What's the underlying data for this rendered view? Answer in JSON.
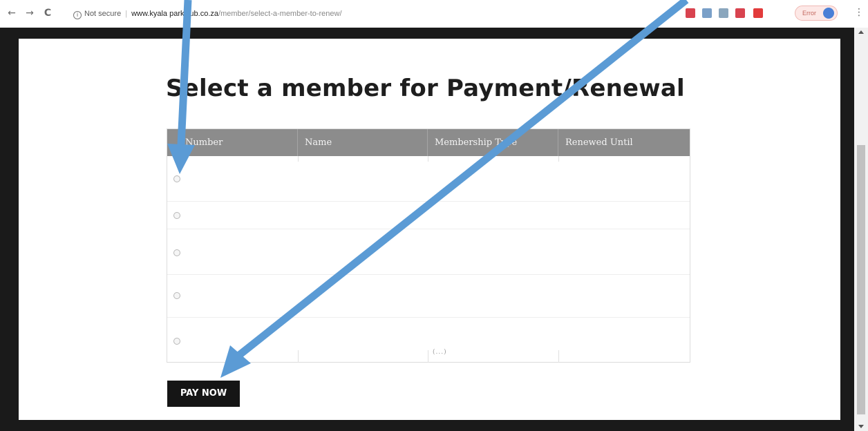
{
  "browser": {
    "back_icon": "←",
    "forward_icon": "→",
    "reload_icon": "C",
    "security_label": "Not secure",
    "url_host": "www.kyala parkclub.co.za",
    "url_path": "/member/select-a-member-to-renew/",
    "bookmark_icon": "☆",
    "profile_status": "Error",
    "menu_icon": "⋮",
    "extension_colors": [
      "#d8434f",
      "#7aa0c8",
      "#8aa6bd",
      "#d8434f",
      "#e23b3b"
    ]
  },
  "page": {
    "title": "Select a member for Payment/Renewal"
  },
  "table": {
    "headers": [
      "Number",
      "Name",
      "Membership Type",
      "Renewed Until"
    ],
    "rows": 5,
    "cell_fragment": "(...)"
  },
  "pay_button_label": "PAY NOW",
  "annotation_color": "#5b9bd5"
}
